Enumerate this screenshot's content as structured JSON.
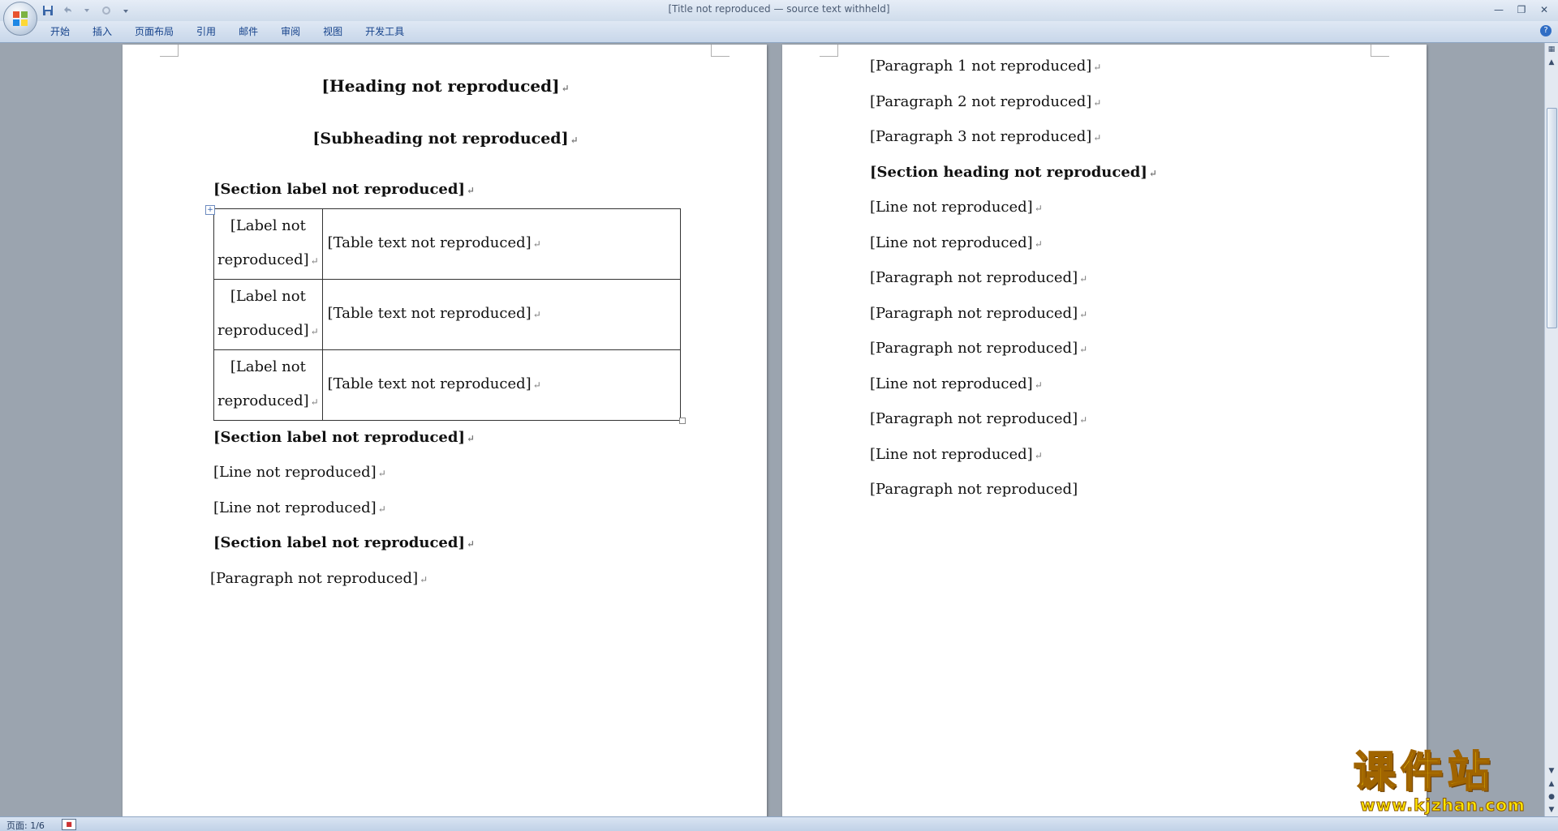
{
  "window": {
    "title": "[Title not reproduced — source text withheld]"
  },
  "quick_access": {
    "save_icon": "save-icon",
    "undo_icon": "undo-icon",
    "redo_icon": "redo-icon",
    "customize_icon": "dropdown-icon"
  },
  "ribbon": {
    "tabs": [
      {
        "label": "开始"
      },
      {
        "label": "插入"
      },
      {
        "label": "页面布局"
      },
      {
        "label": "引用"
      },
      {
        "label": "邮件"
      },
      {
        "label": "审阅"
      },
      {
        "label": "视图"
      },
      {
        "label": "开发工具"
      }
    ],
    "help_label": "?"
  },
  "left_page": {
    "heading": "[Heading not reproduced]",
    "subheading": "[Subheading not reproduced]",
    "section_goals": "[Section label not reproduced]",
    "goals_table": [
      {
        "label": "[Label not reproduced]",
        "text": "[Table text not reproduced]"
      },
      {
        "label": "[Label not reproduced]",
        "text": "[Table text not reproduced]"
      },
      {
        "label": "[Label not reproduced]",
        "text": "[Table text not reproduced]"
      }
    ],
    "section_keypoints": "[Section label not reproduced]",
    "keypoint": "[Line not reproduced]",
    "difficulty": "[Line not reproduced]",
    "section_intro": "[Section label not reproduced]",
    "intro_paragraph": "[Paragraph not reproduced]"
  },
  "right_page": {
    "paragraphs": [
      "[Paragraph 1 not reproduced]",
      "[Paragraph 2 not reproduced]",
      "[Paragraph 3 not reproduced]",
      "[Section heading not reproduced]",
      "[Line not reproduced]",
      "[Line not reproduced]",
      "[Paragraph not reproduced]",
      "[Paragraph not reproduced]",
      "[Paragraph not reproduced]",
      "[Line not reproduced]",
      "[Paragraph not reproduced]",
      "[Line not reproduced]",
      "[Paragraph not reproduced]"
    ]
  },
  "status": {
    "page_label": "页面: 1/6"
  },
  "watermark": {
    "logo_text": "课件站",
    "url": "www.kjzhan.com"
  },
  "colors": {
    "ribbon_text": "#15428b",
    "background": "#9ba4af",
    "watermark_fill": "#ffde00"
  }
}
